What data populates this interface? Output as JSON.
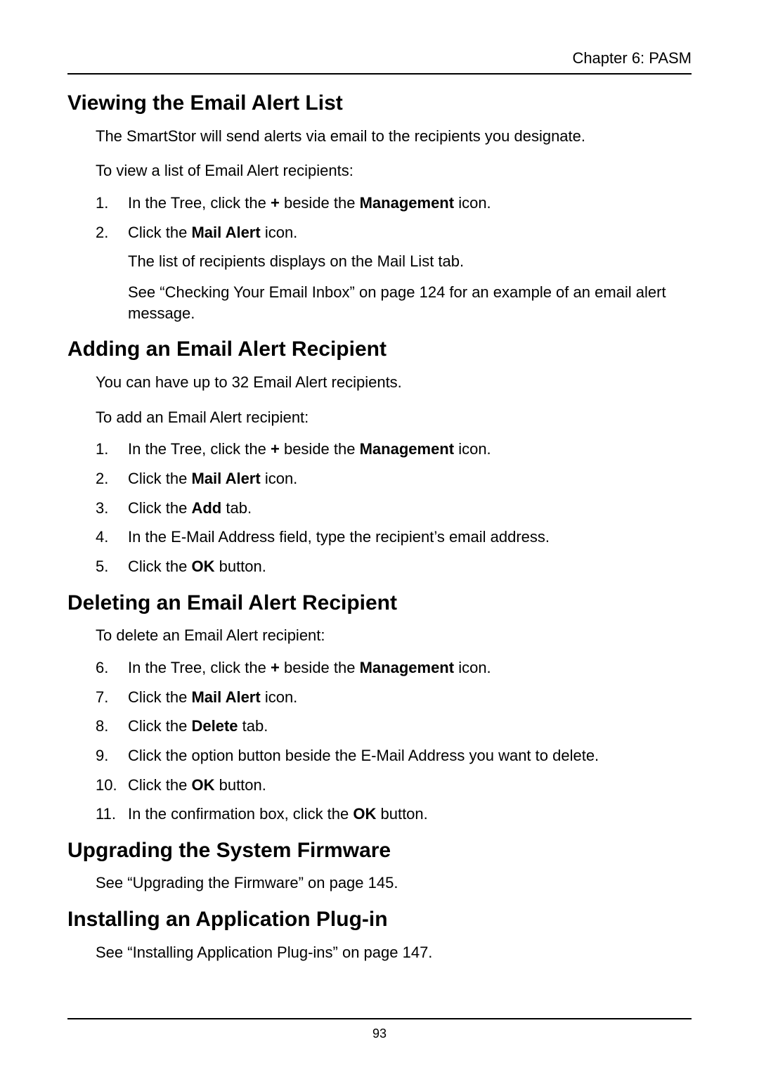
{
  "header": {
    "running": "Chapter 6: PASM"
  },
  "sec1": {
    "title": "Viewing the Email Alert List",
    "p1": "The SmartStor will send alerts via email to the recipients you designate.",
    "p2": "To view a list of Email Alert recipients:",
    "s1": {
      "n": "1.",
      "a": "In the Tree, click the ",
      "b": "+",
      "c": " beside the ",
      "d": "Management",
      "e": " icon."
    },
    "s2": {
      "n": "2.",
      "a": "Click the ",
      "b": "Mail Alert",
      "c": " icon."
    },
    "sub1": "The list of recipients displays on the Mail List tab.",
    "sub2": "See “Checking Your Email Inbox” on page 124 for an example of an email alert message."
  },
  "sec2": {
    "title": "Adding an Email Alert Recipient",
    "p1": "You can have up to 32 Email Alert recipients.",
    "p2": "To add an Email Alert recipient:",
    "s1": {
      "n": "1.",
      "a": "In the Tree, click the ",
      "b": "+",
      "c": " beside the ",
      "d": "Management",
      "e": " icon."
    },
    "s2": {
      "n": "2.",
      "a": "Click the ",
      "b": "Mail Alert",
      "c": " icon."
    },
    "s3": {
      "n": "3.",
      "a": "Click the ",
      "b": "Add",
      "c": " tab."
    },
    "s4": {
      "n": "4.",
      "a": "In the E-Mail Address field, type the recipient’s email address."
    },
    "s5": {
      "n": "5.",
      "a": "Click the ",
      "b": "OK",
      "c": " button."
    }
  },
  "sec3": {
    "title": "Deleting an Email Alert Recipient",
    "p1": "To delete an Email Alert recipient:",
    "s6": {
      "n": "6.",
      "a": "In the Tree, click the ",
      "b": "+",
      "c": " beside the ",
      "d": "Management",
      "e": " icon."
    },
    "s7": {
      "n": "7.",
      "a": "Click the ",
      "b": "Mail Alert",
      "c": " icon."
    },
    "s8": {
      "n": "8.",
      "a": "Click the ",
      "b": "Delete",
      "c": " tab."
    },
    "s9": {
      "n": "9.",
      "a": "Click the option button beside the E-Mail Address you want to delete."
    },
    "s10": {
      "n": "10.",
      "a": "Click the ",
      "b": "OK",
      "c": " button."
    },
    "s11": {
      "n": "11.",
      "a": "In the confirmation box, click the ",
      "b": "OK",
      "c": " button."
    }
  },
  "sec4": {
    "title": "Upgrading the System Firmware",
    "p1": "See “Upgrading the Firmware” on page 145."
  },
  "sec5": {
    "title": "Installing an Application Plug-in",
    "p1": "See “Installing Application Plug-ins” on page 147."
  },
  "footer": {
    "page": "93"
  }
}
